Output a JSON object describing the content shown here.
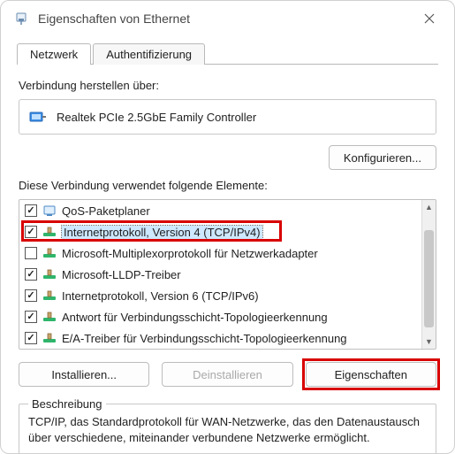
{
  "window": {
    "title": "Eigenschaften von Ethernet"
  },
  "tabs": {
    "network": "Netzwerk",
    "auth": "Authentifizierung"
  },
  "panel": {
    "connect_using_label": "Verbindung herstellen über:",
    "adapter_name": "Realtek PCIe 2.5GbE Family Controller",
    "configure_btn": "Konfigurieren...",
    "items_label": "Diese Verbindung verwendet folgende Elemente:"
  },
  "items": [
    {
      "checked": true,
      "label": "QoS-Paketplaner",
      "icon": "qos"
    },
    {
      "checked": true,
      "label": "Internetprotokoll, Version 4 (TCP/IPv4)",
      "icon": "proto",
      "selected": true
    },
    {
      "checked": false,
      "label": "Microsoft-Multiplexorprotokoll für Netzwerkadapter",
      "icon": "proto"
    },
    {
      "checked": true,
      "label": "Microsoft-LLDP-Treiber",
      "icon": "proto"
    },
    {
      "checked": true,
      "label": "Internetprotokoll, Version 6 (TCP/IPv6)",
      "icon": "proto"
    },
    {
      "checked": true,
      "label": "Antwort für Verbindungsschicht-Topologieerkennung",
      "icon": "proto"
    },
    {
      "checked": true,
      "label": "E/A-Treiber für Verbindungsschicht-Topologieerkennung",
      "icon": "proto"
    }
  ],
  "buttons": {
    "install": "Installieren...",
    "uninstall": "Deinstallieren",
    "properties": "Eigenschaften"
  },
  "description": {
    "legend": "Beschreibung",
    "text": "TCP/IP, das Standardprotokoll für WAN-Netzwerke, das den Datenaustausch über verschiedene, miteinander verbundene Netzwerke ermöglicht."
  }
}
